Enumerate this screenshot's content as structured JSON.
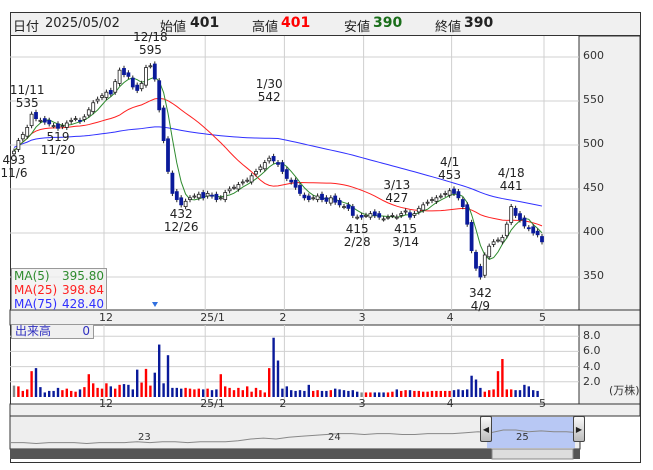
{
  "header": {
    "date_label": "日付",
    "date": "2025/05/02",
    "open_label": "始値",
    "open": "401",
    "high_label": "高値",
    "high": "401",
    "low_label": "安値",
    "low": "390",
    "close_label": "終値",
    "close": "390"
  },
  "legend": {
    "ma5_label": "MA(5)",
    "ma5": "395.80",
    "ma25_label": "MA(25)",
    "ma25": "398.84",
    "ma75_label": "MA(75)",
    "ma75": "428.40"
  },
  "volume_box": {
    "label": "出来高",
    "value": "0"
  },
  "colors": {
    "up": "#ff0000",
    "down": "#0a1a9a",
    "flat": "#888888",
    "ma5": "#2e8b2e",
    "ma25": "#ff2020",
    "ma75": "#3030ff"
  },
  "chart_data": {
    "type": "candlestick",
    "price_ticks": [
      "600",
      "550",
      "500",
      "450",
      "400",
      "350"
    ],
    "price_range": [
      320,
      620
    ],
    "month_ticks": [
      {
        "label": "12",
        "index": 20
      },
      {
        "label": "25/1",
        "index": 43
      },
      {
        "label": "2",
        "index": 61
      },
      {
        "label": "3",
        "index": 79
      },
      {
        "label": "4",
        "index": 99
      },
      {
        "label": "5",
        "index": 120
      }
    ],
    "closes": [
      493,
      505,
      512,
      520,
      535,
      530,
      528,
      526,
      524,
      522,
      519,
      522,
      525,
      528,
      530,
      527,
      532,
      540,
      548,
      552,
      556,
      560,
      558,
      572,
      585,
      580,
      578,
      566,
      562,
      570,
      588,
      590,
      575,
      540,
      505,
      470,
      445,
      438,
      432,
      436,
      440,
      442,
      444,
      440,
      445,
      442,
      438,
      440,
      446,
      450,
      452,
      455,
      458,
      460,
      465,
      470,
      475,
      480,
      485,
      482,
      478,
      470,
      462,
      458,
      452,
      445,
      440,
      438,
      440,
      442,
      438,
      436,
      440,
      435,
      432,
      430,
      428,
      420,
      418,
      418,
      420,
      422,
      420,
      418,
      416,
      418,
      420,
      418,
      422,
      425,
      418,
      422,
      428,
      432,
      435,
      438,
      440,
      442,
      445,
      448,
      445,
      440,
      430,
      410,
      380,
      360,
      350,
      375,
      385,
      390,
      392,
      395,
      410,
      430,
      420,
      415,
      408,
      405,
      400,
      398,
      390
    ],
    "volume_unit": "(万株)",
    "volume_ticks": [
      "8.0",
      "6.0",
      "4.0",
      "2.0"
    ],
    "volumes": [
      1.5,
      1.4,
      0.8,
      1.0,
      3.4,
      3.8,
      1.3,
      0.6,
      0.8,
      0.8,
      1.2,
      0.9,
      1.1,
      0.8,
      0.7,
      1.0,
      1.3,
      3.0,
      1.8,
      1.2,
      1.1,
      1.8,
      1.4,
      1.1,
      1.6,
      1.7,
      1.6,
      1.0,
      3.6,
      1.9,
      3.7,
      1.5,
      3.2,
      6.9,
      1.8,
      5.5,
      1.2,
      1.2,
      1.1,
      1.2,
      1.1,
      1.0,
      1.1,
      1.0,
      1.1,
      0.9,
      1.0,
      3.0,
      1.4,
      1.2,
      0.9,
      1.2,
      0.9,
      1.4,
      0.7,
      1.2,
      0.9,
      0.6,
      3.8,
      7.8,
      4.8,
      1.1,
      1.4,
      0.9,
      0.8,
      0.9,
      0.8,
      1.6,
      0.8,
      0.9,
      0.8,
      0.8,
      0.9,
      1.1,
      1.0,
      0.9,
      0.8,
      0.9,
      0.7,
      0.6,
      0.6,
      0.6,
      0.6,
      0.6,
      0.6,
      0.6,
      0.7,
      1.0,
      0.8,
      0.9,
      0.9,
      0.8,
      0.8,
      0.7,
      0.7,
      0.8,
      0.8,
      0.8,
      0.8,
      0.8,
      0.9,
      1.0,
      0.9,
      1.0,
      2.8,
      2.3,
      1.2,
      0.7,
      0.9,
      1.0,
      3.4,
      5.0,
      1.0,
      1.0,
      0.9,
      0.9,
      1.6,
      1.4,
      0.9,
      0.8
    ],
    "annotations": [
      {
        "date": "11/11",
        "value": "535",
        "index": 3,
        "price": 535,
        "pos": "above"
      },
      {
        "date": "11/6",
        "value": "493",
        "index": 0,
        "price": 493,
        "pos": "below"
      },
      {
        "date": "11/20",
        "value": "519",
        "index": 10,
        "price": 519,
        "pos": "below"
      },
      {
        "date": "12/18",
        "value": "595",
        "index": 31,
        "price": 595,
        "pos": "above"
      },
      {
        "date": "12/26",
        "value": "432",
        "index": 38,
        "price": 432,
        "pos": "below"
      },
      {
        "date": "1/30",
        "value": "542",
        "index": 58,
        "price": 542,
        "pos": "above"
      },
      {
        "date": "2/28",
        "value": "415",
        "index": 78,
        "price": 415,
        "pos": "below"
      },
      {
        "date": "3/13",
        "value": "427",
        "index": 87,
        "price": 427,
        "pos": "above"
      },
      {
        "date": "3/14",
        "value": "415",
        "index": 89,
        "price": 415,
        "pos": "below"
      },
      {
        "date": "4/1",
        "value": "453",
        "index": 99,
        "price": 453,
        "pos": "above"
      },
      {
        "date": "4/9",
        "value": "342",
        "index": 106,
        "price": 342,
        "pos": "below"
      },
      {
        "date": "4/18",
        "value": "441",
        "index": 113,
        "price": 441,
        "pos": "above"
      }
    ]
  },
  "navigator": {
    "year_labels": [
      "23",
      "24",
      "25"
    ],
    "series": [
      46,
      46,
      45,
      46,
      46,
      46,
      45,
      46,
      46,
      46,
      47,
      46,
      47,
      47,
      46,
      47,
      47,
      47,
      48,
      50,
      51,
      50,
      52,
      53,
      54,
      55,
      56,
      56,
      55,
      56,
      56,
      55,
      55,
      56,
      56,
      56,
      57,
      58,
      57,
      60,
      60,
      58,
      59,
      58,
      58,
      57
    ]
  }
}
